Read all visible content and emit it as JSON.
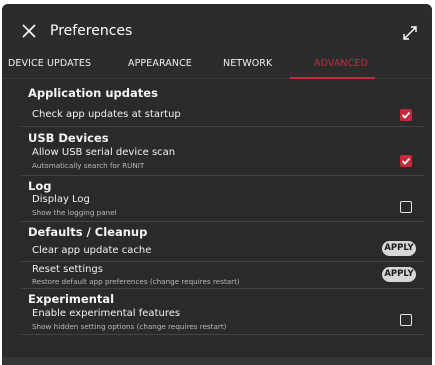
{
  "window": {
    "title": "Preferences",
    "close_icon": "close-icon",
    "expand_icon": "expand-icon"
  },
  "tabs": [
    {
      "label": "DEVICE UPDATES",
      "active": false
    },
    {
      "label": "APPEARANCE",
      "active": false
    },
    {
      "label": "NETWORK",
      "active": false
    },
    {
      "label": "ADVANCED",
      "active": true
    }
  ],
  "colors": {
    "accent": "#c22a3e",
    "background": "#2a2a2a",
    "apply_button": "#d6d6d6"
  },
  "sections": [
    {
      "title": "Application updates",
      "rows": [
        {
          "label": "Check app updates at startup",
          "sublabel": "",
          "control": "checkbox",
          "checked": true
        }
      ]
    },
    {
      "title": "USB Devices",
      "rows": [
        {
          "label": "Allow USB serial device scan",
          "sublabel": "Automatically search for RUNIT",
          "control": "checkbox",
          "checked": true
        }
      ]
    },
    {
      "title": "Log",
      "rows": [
        {
          "label": "Display Log",
          "sublabel": "Show the logging panel",
          "control": "checkbox",
          "checked": false
        }
      ]
    },
    {
      "title": "Defaults / Cleanup",
      "rows": [
        {
          "label": "Clear app update cache",
          "sublabel": "",
          "control": "button",
          "button_label": "APPLY"
        },
        {
          "label": "Reset settings",
          "sublabel": "Restore default app preferences (change requires restart)",
          "control": "button",
          "button_label": "APPLY"
        }
      ]
    },
    {
      "title": "Experimental",
      "rows": [
        {
          "label": "Enable experimental features",
          "sublabel": "Show hidden setting options (change requires restart)",
          "control": "checkbox",
          "checked": false
        }
      ]
    }
  ]
}
